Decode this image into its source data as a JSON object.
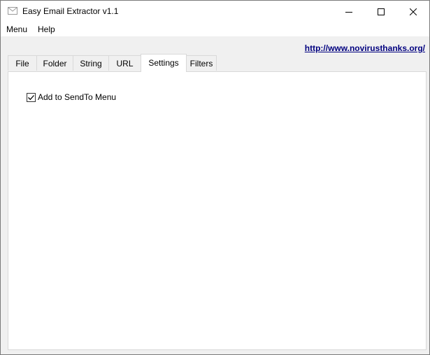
{
  "window": {
    "title": "Easy Email Extractor v1.1",
    "app_icon": "envelope-icon",
    "controls": [
      "minimize-icon",
      "maximize-icon",
      "close-icon"
    ]
  },
  "menubar": {
    "items": [
      {
        "label": "Menu"
      },
      {
        "label": "Help"
      }
    ]
  },
  "link": {
    "text": "http://www.novirusthanks.org/"
  },
  "tabs": {
    "items": [
      {
        "label": "File"
      },
      {
        "label": "Folder"
      },
      {
        "label": "String"
      },
      {
        "label": "URL"
      },
      {
        "label": "Settings"
      },
      {
        "label": "Filters"
      }
    ],
    "active": "Settings"
  },
  "settings": {
    "sendto_checkbox": {
      "label": "Add to SendTo Menu",
      "checked": true
    }
  }
}
